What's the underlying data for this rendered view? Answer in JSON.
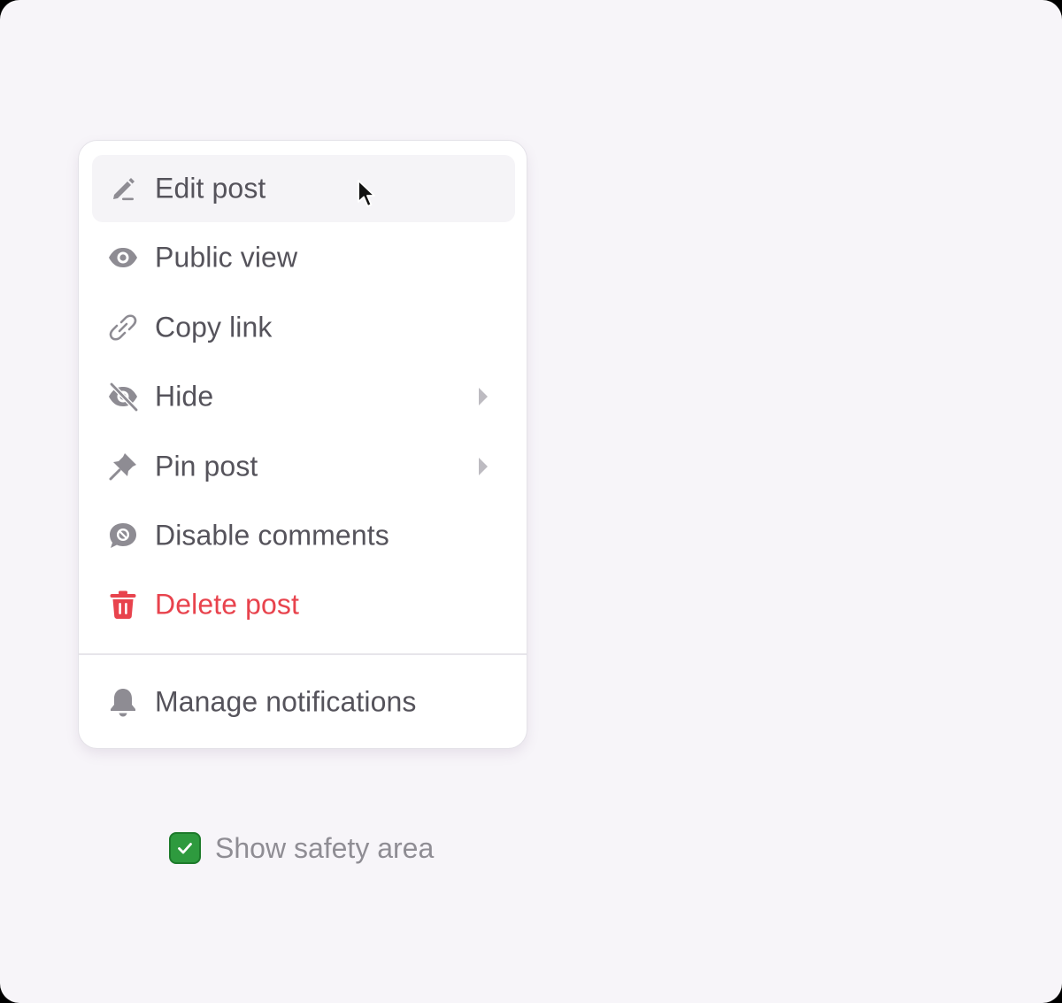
{
  "menu": {
    "items": [
      {
        "label": "Edit post",
        "icon": "pencil-icon",
        "hovered": true
      },
      {
        "label": "Public view",
        "icon": "eye-icon"
      },
      {
        "label": "Copy link",
        "icon": "link-icon"
      },
      {
        "label": "Hide",
        "icon": "eye-slash-icon",
        "submenu": true
      },
      {
        "label": "Pin post",
        "icon": "pin-icon",
        "submenu": true
      },
      {
        "label": "Disable comments",
        "icon": "comment-disabled-icon"
      },
      {
        "label": "Delete post",
        "icon": "trash-icon",
        "danger": true
      }
    ],
    "footer_item": {
      "label": "Manage notifications",
      "icon": "bell-icon"
    }
  },
  "safety_area": {
    "label": "Show safety area",
    "checked": true
  },
  "colors": {
    "background": "#f7f5f9",
    "menu_text": "#55535b",
    "danger": "#e8434d",
    "icon_gray": "#8e8c93",
    "checkbox_green": "#2e9a3e",
    "muted_text": "#8f8d94"
  }
}
